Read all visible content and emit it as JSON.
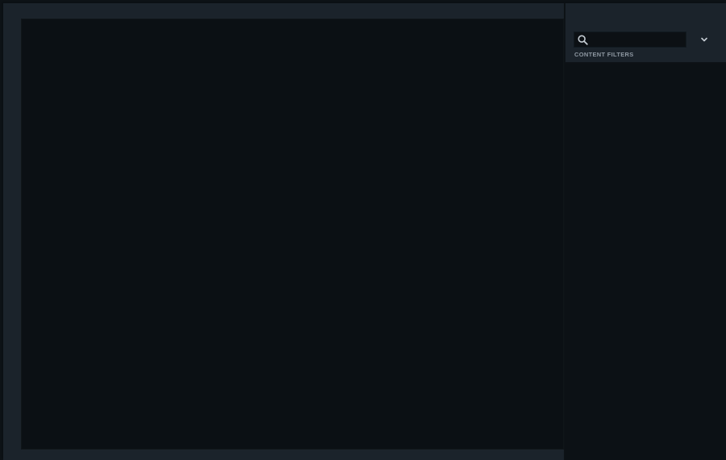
{
  "side_panel": {
    "search": {
      "value": "",
      "placeholder": ""
    },
    "filters_label": "CONTENT FILTERS",
    "icons": {
      "search": "search-icon",
      "dropdown": "chevron-down-icon"
    }
  },
  "colors": {
    "panel": "#1b232b",
    "viewport": "#0b1014",
    "label": "#8d97a1"
  }
}
